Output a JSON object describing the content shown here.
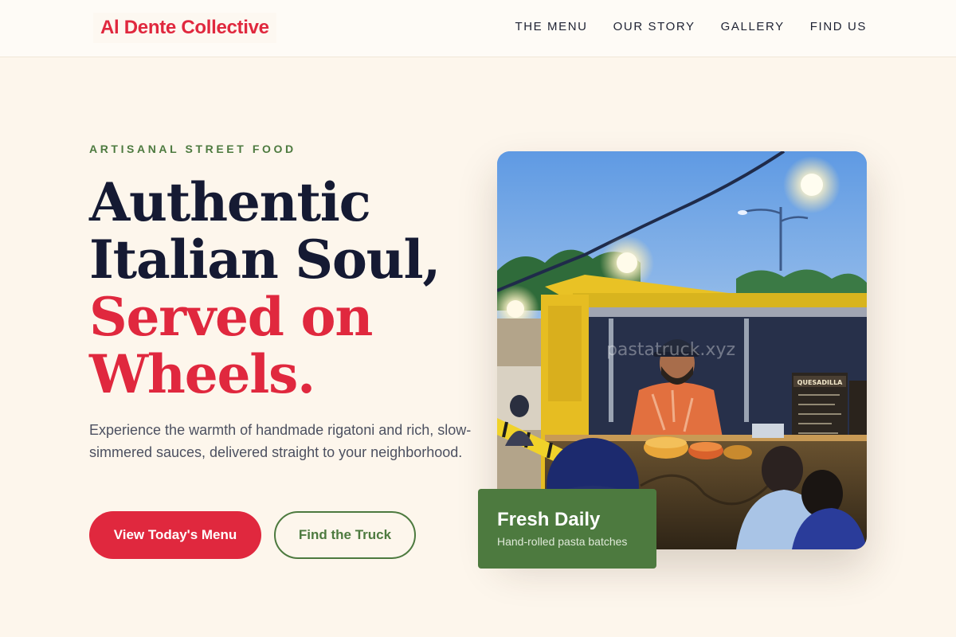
{
  "header": {
    "brand": "Al Dente Collective",
    "nav": [
      {
        "label": "THE MENU"
      },
      {
        "label": "OUR STORY"
      },
      {
        "label": "GALLERY"
      },
      {
        "label": "FIND US"
      }
    ]
  },
  "hero": {
    "eyebrow": "ARTISANAL STREET FOOD",
    "headline": {
      "line1": "Authentic",
      "line2": "Italian Soul,",
      "line3": "Served on",
      "line4": "Wheels."
    },
    "description": "Experience the warmth of handmade rigatoni and rich, slow-simmered sauces, delivered straight to your neighborhood.",
    "primary_cta": "View Today's Menu",
    "secondary_cta": "Find the Truck"
  },
  "photo": {
    "watermark": "pastatruck.xyz",
    "sign_text": "QUESADILLA"
  },
  "badge": {
    "title": "Fresh Daily",
    "subtitle": "Hand-rolled pasta batches"
  },
  "colors": {
    "background": "#fdf6ec",
    "accent_red": "#e0283e",
    "accent_green": "#4d7a3f",
    "heading_dark": "#151a33"
  }
}
